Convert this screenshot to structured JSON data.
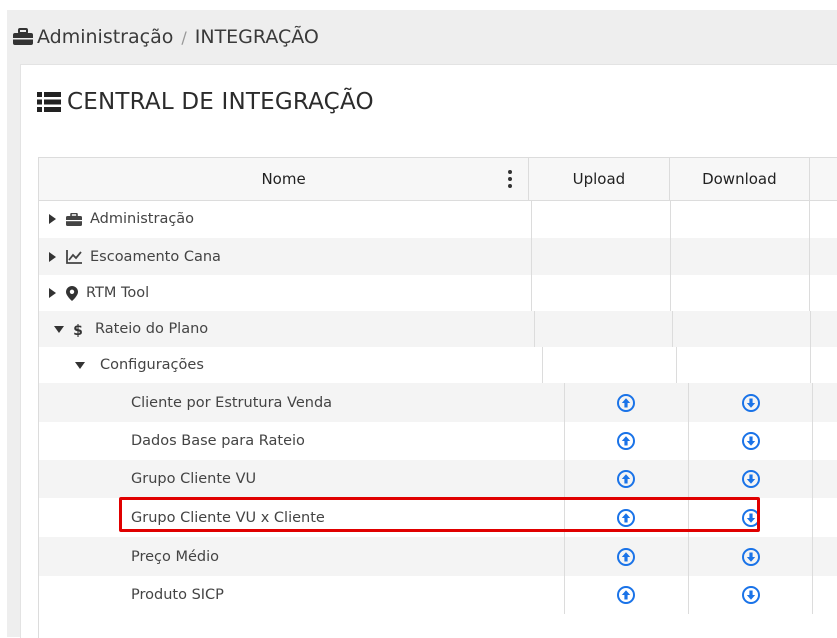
{
  "breadcrumb": {
    "parent": "Administração",
    "separator": "/",
    "current": "INTEGRAÇÃO"
  },
  "page": {
    "title": "CENTRAL DE INTEGRAÇÃO"
  },
  "grid": {
    "columns": [
      "Nome",
      "Upload",
      "Download"
    ],
    "rows": [
      {
        "label": "Administração",
        "icon": "briefcase-icon",
        "expanded": false,
        "upload": false,
        "download": false
      },
      {
        "label": "Escoamento Cana",
        "icon": "line-chart-icon",
        "expanded": false,
        "upload": false,
        "download": false
      },
      {
        "label": "RTM Tool",
        "icon": "map-marker-icon",
        "expanded": false,
        "upload": false,
        "download": false
      },
      {
        "label": "Rateio do Plano",
        "icon": "dollar-icon",
        "expanded": true,
        "upload": false,
        "download": false
      },
      {
        "label": "Configurações",
        "expanded": true,
        "upload": false,
        "download": false
      },
      {
        "label": "Cliente por Estrutura Venda",
        "upload": true,
        "download": true
      },
      {
        "label": "Dados Base para Rateio",
        "upload": true,
        "download": true
      },
      {
        "label": "Grupo Cliente VU",
        "upload": true,
        "download": true
      },
      {
        "label": "Grupo Cliente VU x Cliente",
        "upload": true,
        "download": true,
        "highlighted": true
      },
      {
        "label": "Preço Médio",
        "upload": true,
        "download": true
      },
      {
        "label": "Produto SICP",
        "upload": true,
        "download": true
      }
    ]
  },
  "colors": {
    "accent": "#1a73e8",
    "highlight": "#e00000"
  }
}
